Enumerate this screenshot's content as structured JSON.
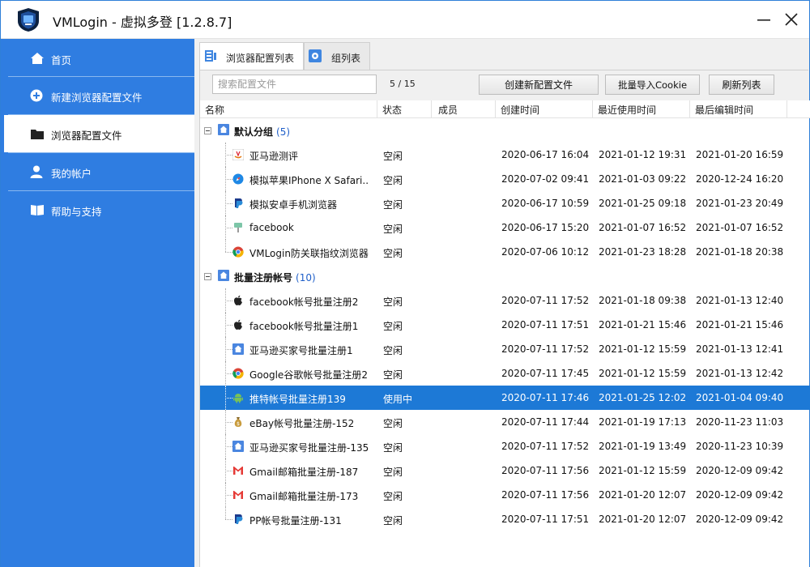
{
  "window": {
    "title": "VMLogin - 虚拟多登 [1.2.8.7]"
  },
  "colors": {
    "sidebar": "#2f7de1",
    "selection": "#1d79d6",
    "accent": "#1f5fc9"
  },
  "sidebar": {
    "items": [
      {
        "label": "首页",
        "icon": "home-icon"
      },
      {
        "label": "新建浏览器配置文件",
        "icon": "plus-circle-icon"
      },
      {
        "label": "浏览器配置文件",
        "icon": "folder-icon",
        "active": true
      },
      {
        "label": "我的帐户",
        "icon": "user-icon"
      },
      {
        "label": "帮助与支持",
        "icon": "book-icon"
      }
    ]
  },
  "tabs": [
    {
      "label": "浏览器配置列表",
      "active": true
    },
    {
      "label": "组列表",
      "active": false
    }
  ],
  "toolbar": {
    "search_placeholder": "搜索配置文件",
    "count": "5 / 15",
    "create_label": "创建新配置文件",
    "import_label": "批量导入Cookie",
    "refresh_label": "刷新列表"
  },
  "table": {
    "headers": {
      "name": "名称",
      "status": "状态",
      "members": "成员",
      "created": "创建时间",
      "last_used": "最近使用时间",
      "last_edited": "最后编辑时间"
    },
    "groups": [
      {
        "name": "默认分组",
        "count": "(5)",
        "rows": [
          {
            "name": "亚马逊测评",
            "icon": "amazon-icon",
            "status": "空闲",
            "created": "2020-06-17 16:04",
            "last_used": "2021-01-12 19:31",
            "last_edited": "2021-01-20 16:59"
          },
          {
            "name": "模拟苹果IPhone X Safari...",
            "icon": "safari-icon",
            "status": "空闲",
            "created": "2020-07-02 09:41",
            "last_used": "2021-01-03 09:22",
            "last_edited": "2020-12-24 16:20"
          },
          {
            "name": "模拟安卓手机浏览器",
            "icon": "paypal-icon",
            "status": "空闲",
            "created": "2020-06-17 10:59",
            "last_used": "2021-01-25 09:18",
            "last_edited": "2021-01-23 20:49"
          },
          {
            "name": "facebook",
            "icon": "pin-icon",
            "status": "空闲",
            "created": "2020-06-17 15:20",
            "last_used": "2021-01-07 16:52",
            "last_edited": "2021-01-07 16:52"
          },
          {
            "name": "VMLogin防关联指纹浏览器",
            "icon": "chrome-icon",
            "status": "空闲",
            "created": "2020-07-06 10:12",
            "last_used": "2021-01-23 18:28",
            "last_edited": "2021-01-18 20:38"
          }
        ]
      },
      {
        "name": "批量注册帐号",
        "count": "(10)",
        "rows": [
          {
            "name": "facebook帐号批量注册2",
            "icon": "apple-icon",
            "status": "空闲",
            "created": "2020-07-11 17:52",
            "last_used": "2021-01-18 09:38",
            "last_edited": "2021-01-13 12:40"
          },
          {
            "name": "facebook帐号批量注册1",
            "icon": "apple-icon",
            "status": "空闲",
            "created": "2020-07-11 17:51",
            "last_used": "2021-01-21 15:46",
            "last_edited": "2021-01-21 15:46"
          },
          {
            "name": "亚马逊买家号批量注册1",
            "icon": "home-square-icon",
            "status": "空闲",
            "created": "2020-07-11 17:52",
            "last_used": "2021-01-12 15:59",
            "last_edited": "2021-01-13 12:41"
          },
          {
            "name": "Google谷歌帐号批量注册2",
            "icon": "chrome-icon",
            "status": "空闲",
            "created": "2020-07-11 17:45",
            "last_used": "2021-01-12 15:59",
            "last_edited": "2021-01-13 12:42"
          },
          {
            "name": "推特帐号批量注册139",
            "icon": "android-icon",
            "status": "使用中",
            "created": "2020-07-11 17:46",
            "last_used": "2021-01-25 12:02",
            "last_edited": "2021-01-04 09:40",
            "selected": true
          },
          {
            "name": "eBay帐号批量注册-152",
            "icon": "money-bag-icon",
            "status": "空闲",
            "created": "2020-07-11 17:44",
            "last_used": "2021-01-19 17:13",
            "last_edited": "2020-11-23 11:03"
          },
          {
            "name": "亚马逊买家号批量注册-135",
            "icon": "home-square-icon",
            "status": "空闲",
            "created": "2020-07-11 17:52",
            "last_used": "2021-01-19 13:49",
            "last_edited": "2020-11-23 10:39"
          },
          {
            "name": "Gmail邮箱批量注册-187",
            "icon": "gmail-icon",
            "status": "空闲",
            "created": "2020-07-11 17:56",
            "last_used": "2021-01-12 15:59",
            "last_edited": "2020-12-09 09:42"
          },
          {
            "name": "Gmail邮箱批量注册-173",
            "icon": "gmail-icon",
            "status": "空闲",
            "created": "2020-07-11 17:56",
            "last_used": "2021-01-20 12:07",
            "last_edited": "2020-12-09 09:42"
          },
          {
            "name": "PP帐号批量注册-131",
            "icon": "paypal-icon",
            "status": "空闲",
            "created": "2020-07-11 17:51",
            "last_used": "2021-01-20 12:07",
            "last_edited": "2020-12-09 09:42"
          }
        ]
      }
    ]
  }
}
